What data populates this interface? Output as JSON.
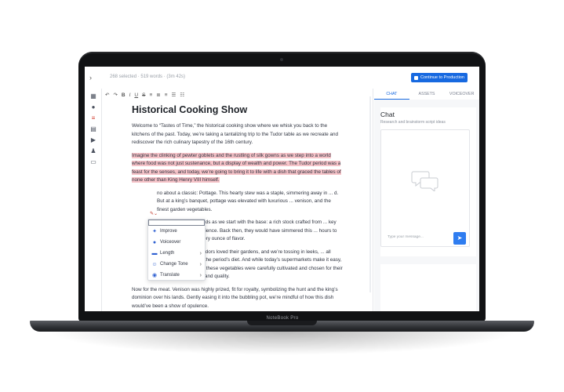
{
  "device": {
    "brand": "NoteBook Pro"
  },
  "topbar": {
    "status_text": "268 selected · 519 words · (3m 42s)",
    "cta_label": "Continue to Production"
  },
  "toolbar": {
    "items": [
      "↶",
      "↷",
      "B",
      "I",
      "U",
      "S",
      "≡",
      "≣",
      "≡",
      "☰",
      "☷"
    ]
  },
  "document": {
    "title": "Historical Cooking Show",
    "para1": "Welcome to “Tastes of Time,” the historical cooking show where we whisk you back to the kitchens of the past. Today, we’re taking a tantalizing trip to the Tudor table as we recreate and rediscover the rich culinary tapestry of the 16th century.",
    "para2_highlighted": "Imagine the clinking of pewter goblets and the rustling of silk gowns as we step into a world where food was not just sustenance, but a display of wealth and power. The Tudor period was a feast for the senses, and today, we’re going to bring it to life with a dish that graced the tables of none other than King Henry VIII himself.",
    "para3": "no about a classic: Pottage. This hearty stew was a staple, simmering away in ... d. But at a king’s banquet, pottage was elevated with luxurious ... venison, and the finest garden vegetables.",
    "para4": "ur taste buds as we start with the base: a rich stock crafted from ... key here is patience. Back then, they would have simmered this ... hours to extract every ounce of flavor.",
    "para5": "roduce. Tudors loved their gardens, and we’re tossing in leeks, ... all staples of the period’s diet. And while today’s supermarkets make it easy, back then, these vegetables were carefully cultivated and chosen for their freshness and quality.",
    "para6": "Now for the meat. Venison was highly prized, fit for royalty, symbolizing the hunt and the king’s dominion over his lands. Gently easing it into the bubbling pot, we’re mindful of how this dish would’ve been a show of opulence."
  },
  "context_menu": {
    "items": [
      {
        "label": "Improve",
        "icon": "wand-icon",
        "glyph": "✦"
      },
      {
        "label": "Voiceover",
        "icon": "microphone-icon",
        "glyph": "🎙"
      },
      {
        "label": "Length",
        "icon": "length-icon",
        "glyph": "▬",
        "submenu": true
      },
      {
        "label": "Change Tone",
        "icon": "tone-icon",
        "glyph": "☺",
        "submenu": true
      },
      {
        "label": "Translate",
        "icon": "globe-icon",
        "glyph": "◉",
        "submenu": true
      }
    ]
  },
  "right_panel": {
    "tabs": [
      "CHAT",
      "ASSETS",
      "VOICEOVER"
    ],
    "active_tab": "CHAT",
    "chat_title": "Chat",
    "chat_subtitle": "Research and brainstorm script ideas",
    "message_placeholder": "Type your message..."
  },
  "colors": {
    "accent": "#1769e0",
    "highlight": "#f6c3c8"
  }
}
